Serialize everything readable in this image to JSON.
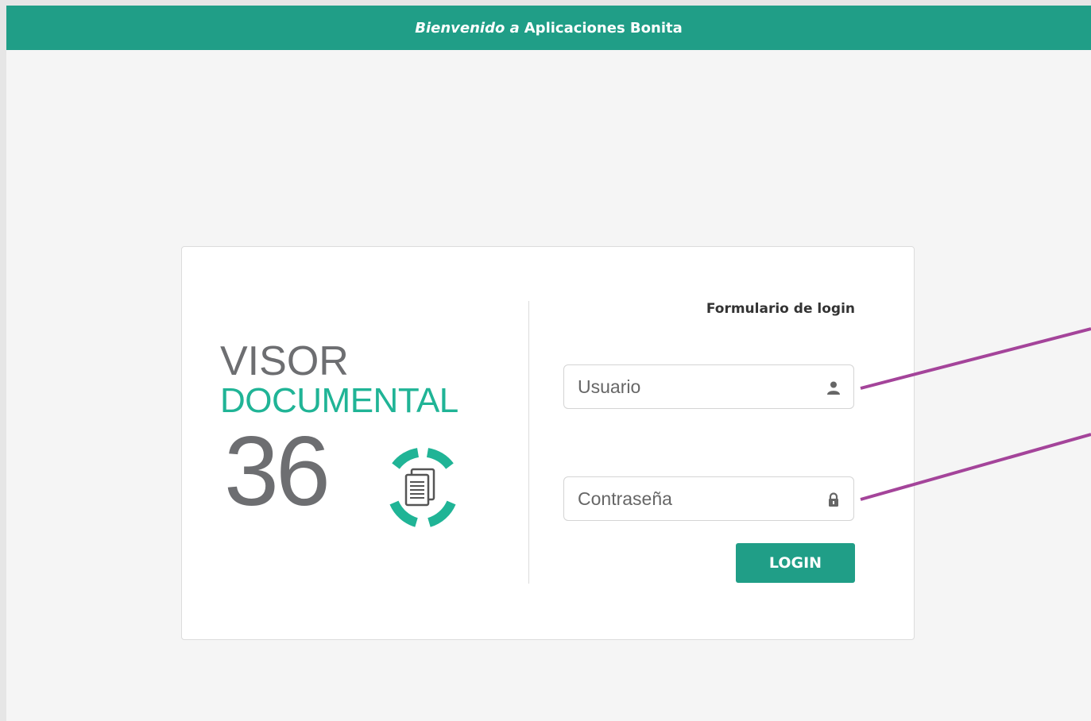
{
  "header": {
    "welcome": "Bienvenido a",
    "app_name": "Aplicaciones Bonita"
  },
  "logo": {
    "line1": "VISOR",
    "line2": "DOCUMENTAL",
    "line3": "36"
  },
  "form": {
    "title": "Formulario de login",
    "username_placeholder": "Usuario",
    "password_placeholder": "Contraseña",
    "login_label": "LOGIN"
  },
  "icons": {
    "username": "user-icon",
    "password": "lock-icon",
    "logo_mark": "document-circle-icon"
  },
  "colors": {
    "brand": "#209e87",
    "logo_gray": "#6d6e71",
    "logo_green": "#20b496",
    "annotation": "#a4449a"
  }
}
